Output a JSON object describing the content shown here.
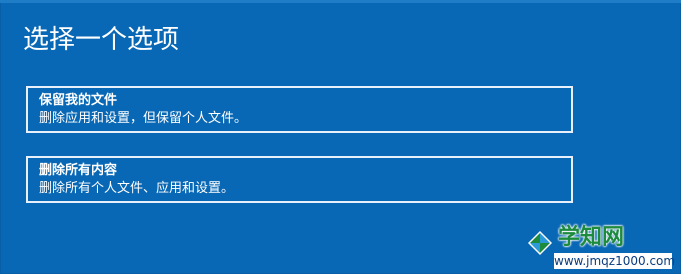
{
  "title": "选择一个选项",
  "options": [
    {
      "heading": "保留我的文件",
      "description": "删除应用和设置，但保留个人文件。"
    },
    {
      "heading": "删除所有内容",
      "description": "删除所有个人文件、应用和设置。"
    }
  ],
  "watermark": {
    "site_name": "学知网",
    "url": "www.jmqz1000.com",
    "logo_icon": "windows-logo-icon"
  },
  "colors": {
    "background": "#0968b5",
    "border": "#e8f1fb",
    "text": "#ffffff",
    "watermark_green": "#1c8b3e"
  }
}
